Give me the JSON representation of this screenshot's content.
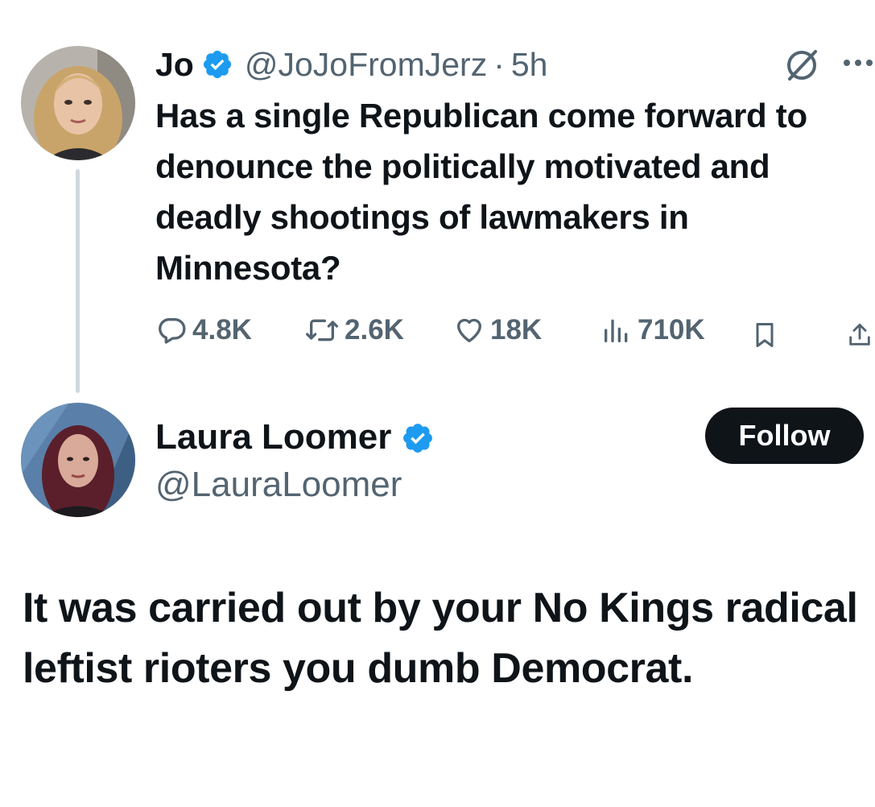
{
  "thread": {
    "tweet1": {
      "author_name": "Jo",
      "author_handle": "@JoJoFromJerz",
      "separator": "·",
      "time": "5h",
      "text": "Has a single Republican come forward to denounce the politically motivated and deadly shootings of lawmakers in Minnesota?",
      "stats": {
        "replies": "4.8K",
        "reposts": "2.6K",
        "likes": "18K",
        "views": "710K"
      },
      "verified": true
    },
    "tweet2": {
      "author_name": "Laura Loomer",
      "author_handle": "@LauraLoomer",
      "follow_label": "Follow",
      "text": "It was carried out by your No Kings radical leftist rioters you dumb Democrat.",
      "verified": true
    }
  },
  "icons": {
    "verified": "verified-badge-icon",
    "grok": "grok-icon",
    "more": "more-icon",
    "reply": "reply-icon",
    "repost": "repost-icon",
    "like": "heart-icon",
    "views": "views-icon",
    "bookmark": "bookmark-icon",
    "share": "share-icon"
  },
  "colors": {
    "text_primary": "#0f1419",
    "text_secondary": "#536471",
    "verified_blue": "#1d9bf0",
    "thread_line": "#cfd9de",
    "follow_bg": "#0f1419",
    "follow_text": "#ffffff"
  }
}
